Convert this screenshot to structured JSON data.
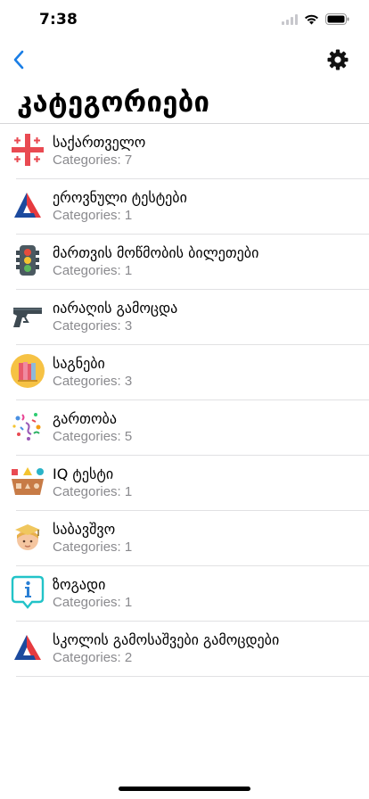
{
  "status_bar": {
    "time": "7:38"
  },
  "nav": {
    "title": "კატეგორიები"
  },
  "colors": {
    "accent": "#1a7ee6",
    "secondary_text": "#8a8a8e",
    "separator": "#e1e1e3"
  },
  "items": [
    {
      "icon": "georgian-flag-icon",
      "title": "საქართველო",
      "subtitle": "Categories: 7"
    },
    {
      "icon": "delta-logo-icon",
      "title": "ეროვნული ტესტები",
      "subtitle": "Categories: 1"
    },
    {
      "icon": "traffic-light-icon",
      "title": "მართვის მოწმობის ბილეთები",
      "subtitle": "Categories: 1"
    },
    {
      "icon": "pistol-icon",
      "title": "იარაღის გამოცდა",
      "subtitle": "Categories: 3"
    },
    {
      "icon": "books-icon",
      "title": "საგნები",
      "subtitle": "Categories: 3"
    },
    {
      "icon": "confetti-icon",
      "title": "გართობა",
      "subtitle": "Categories: 5"
    },
    {
      "icon": "shapes-icon",
      "title": "IQ ტესტი",
      "subtitle": "Categories: 1"
    },
    {
      "icon": "graduate-icon",
      "title": "საბავშვო",
      "subtitle": "Categories: 1"
    },
    {
      "icon": "info-bubble-icon",
      "title": "ზოგადი",
      "subtitle": "Categories: 1"
    },
    {
      "icon": "delta-logo-icon",
      "title": "სკოლის გამოსაშვები გამოცდები",
      "subtitle": "Categories: 2"
    }
  ]
}
